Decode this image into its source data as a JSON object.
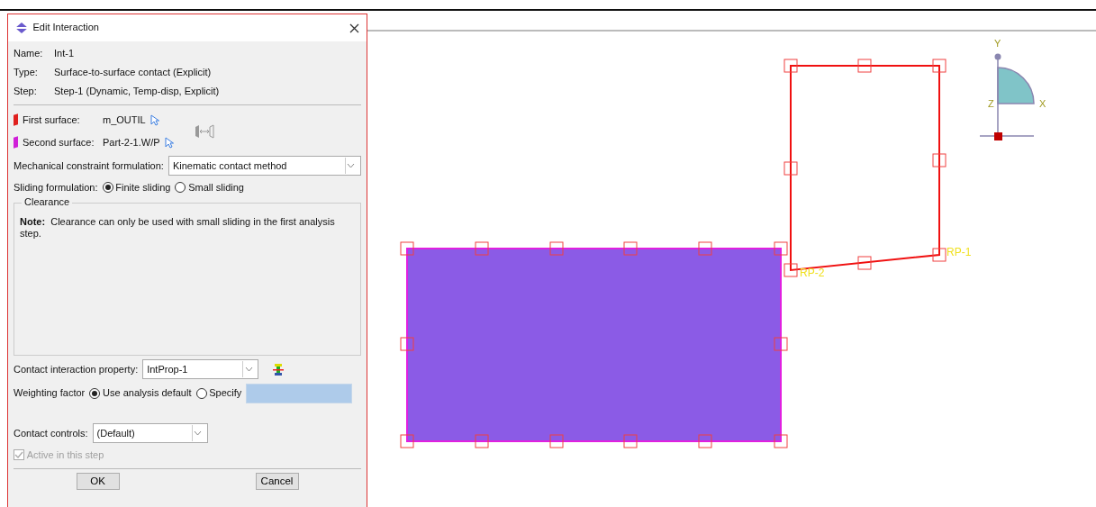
{
  "dialog": {
    "title": "Edit Interaction",
    "info": [
      {
        "label": "Name:",
        "value": "Int-1"
      },
      {
        "label": "Type:",
        "value": "Surface-to-surface contact (Explicit)"
      },
      {
        "label": "Step:",
        "value": "Step-1 (Dynamic, Temp-disp, Explicit)"
      }
    ],
    "surfaces": [
      {
        "label": "First surface:",
        "value": "m_OUTIL",
        "color": "#e0201e"
      },
      {
        "label": "Second surface:",
        "value": "Part-2-1.W/P",
        "color": "#d020d8"
      }
    ],
    "constraint": {
      "label": "Mechanical constraint formulation:",
      "value": "Kinematic contact method"
    },
    "sliding": {
      "label": "Sliding formulation:",
      "options": [
        {
          "label": "Finite sliding",
          "selected": true
        },
        {
          "label": "Small sliding",
          "selected": false
        }
      ]
    },
    "clearance": {
      "title": "Clearance",
      "note_label": "Note:",
      "note": "Clearance can only be used with small sliding in the first analysis step."
    },
    "property": {
      "label": "Contact interaction property:",
      "value": "IntProp-1"
    },
    "weighting": {
      "label": "Weighting factor",
      "options": [
        {
          "label": "Use analysis default",
          "selected": true
        },
        {
          "label": "Specify",
          "selected": false
        }
      ]
    },
    "controls": {
      "label": "Contact controls:",
      "value": "(Default)"
    },
    "active": {
      "label": "Active in this step",
      "checked": true,
      "disabled": true
    },
    "buttons": [
      "OK",
      "Cancel"
    ]
  },
  "viewport": {
    "reference_points": [
      "RP-1",
      "RP-2"
    ],
    "axes": {
      "y": "Y",
      "x": "X",
      "z": "Z"
    }
  }
}
